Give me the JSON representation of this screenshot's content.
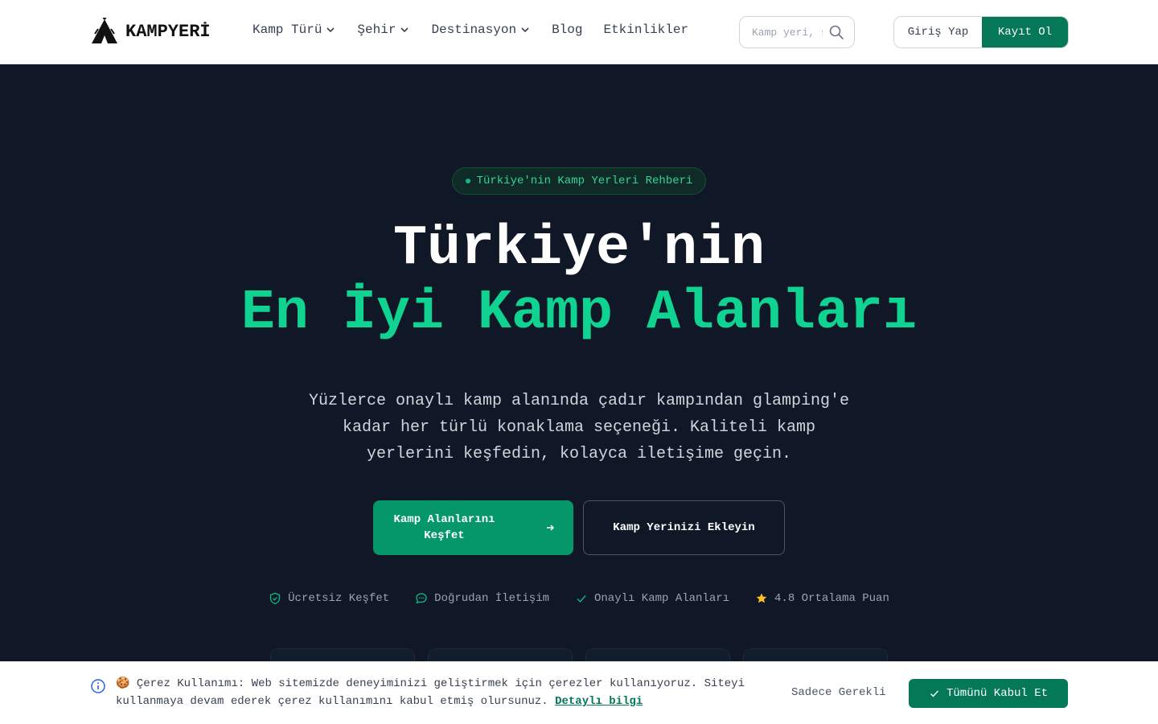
{
  "header": {
    "logo_text": "KAMPYERİ",
    "nav": [
      {
        "label": "Kamp Türü",
        "has_dropdown": true
      },
      {
        "label": "Şehir",
        "has_dropdown": true
      },
      {
        "label": "Destinasyon",
        "has_dropdown": true
      },
      {
        "label": "Blog",
        "has_dropdown": false
      },
      {
        "label": "Etkinlikler",
        "has_dropdown": false
      }
    ],
    "search_placeholder": "Kamp yeri, şehir ara...",
    "login_label": "Giriş Yap",
    "register_label": "Kayıt Ol"
  },
  "hero": {
    "badge": "Türkiye'nin Kamp Yerleri Rehberi",
    "title_line1": "Türkiye'nin",
    "title_line2": "En İyi Kamp Alanları",
    "description": "Yüzlerce onaylı kamp alanında çadır kampından glamping'e kadar her türlü konaklama seçeneği. Kaliteli kamp yerlerini keşfedin, kolayca iletişime geçin.",
    "cta_primary": "Kamp Alanlarını Keşfet",
    "cta_secondary": "Kamp Yerinizi Ekleyin",
    "features": [
      {
        "label": "Ücretsiz Keşfet",
        "icon": "shield-check-icon"
      },
      {
        "label": "Doğrudan İletişim",
        "icon": "chat-icon"
      },
      {
        "label": "Onaylı Kamp Alanları",
        "icon": "check-icon"
      },
      {
        "label": "4.8 Ortalama Puan",
        "icon": "star-icon"
      }
    ]
  },
  "cookie": {
    "emoji": "🍪",
    "title": "Çerez Kullanımı:",
    "text": "Web sitemizde deneyiminizi geliştirmek için çerezler kullanıyoruz. Siteyi kullanmaya devam ederek çerez kullanımını kabul etmiş olursunuz.",
    "link": "Detaylı bilgi",
    "necessary_label": "Sadece Gerekli",
    "accept_label": "Tümünü Kabul Et"
  },
  "colors": {
    "accent": "#10d391",
    "button_green": "#047857",
    "hero_bg": "#101828",
    "star": "#fbbf24"
  }
}
